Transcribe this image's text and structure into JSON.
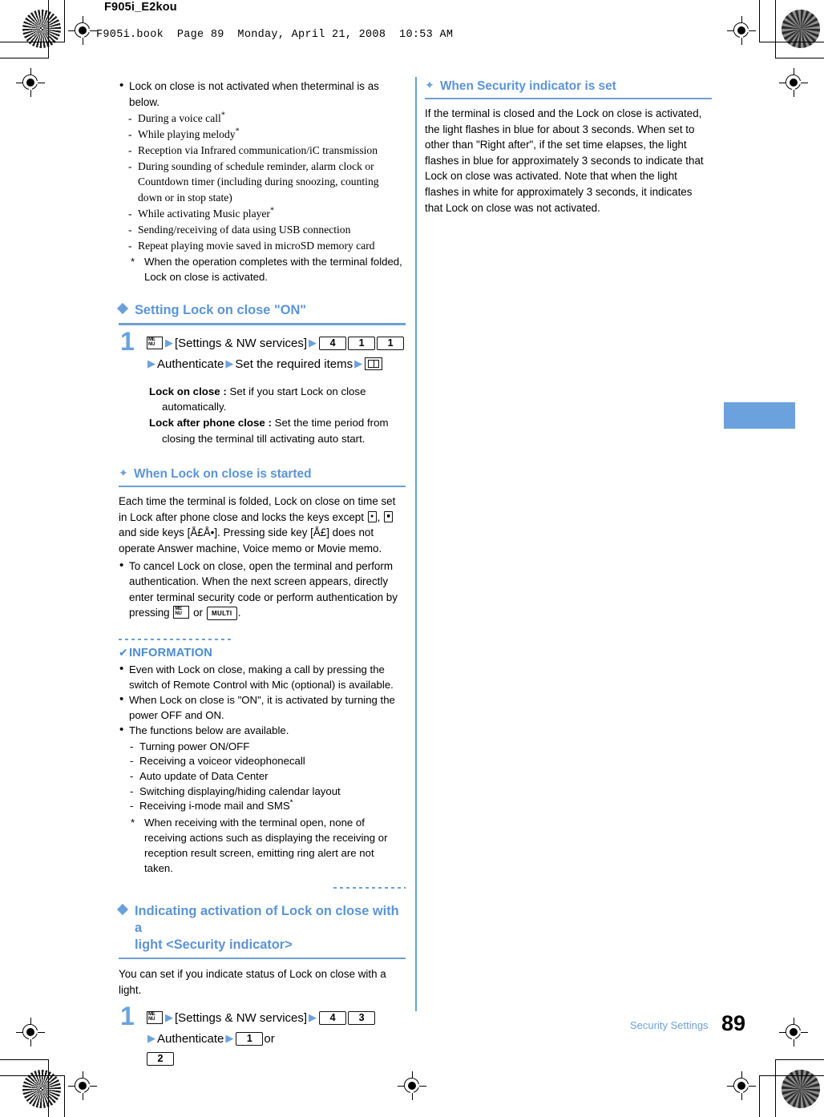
{
  "header": {
    "doc_id": "F905i_E2kou",
    "book_line": "F905i.book  Page 89  Monday, April 21, 2008  10:53 AM"
  },
  "colors": {
    "accent_blue": "#6ba2dd",
    "heading_blue": "#5b94d6",
    "rule_blue": "#6b9fd4"
  },
  "left_column": {
    "intro_bullet": "Lock on close is not activated when theterminal is as below.",
    "intro_dashes": [
      "During a voice call",
      "While playing melody",
      "Reception via Infrared communication/iC transmission",
      "During sounding of schedule reminder, alarm clock or Countdown timer (including during snoozing, counting down or in stop state)",
      "While activating Music player",
      "Sending/receiving of data using USB connection",
      "Repeat playing movie saved in microSD memory card"
    ],
    "intro_dash_asterisk": [
      true,
      true,
      false,
      false,
      true,
      false,
      false
    ],
    "intro_footnote": "When the operation completes with the terminal folded, Lock on close is activated.",
    "section1": {
      "heading": "Setting Lock on close \"ON\"",
      "step_number": "1",
      "step_parts": [
        {
          "type": "icon",
          "icon": "menu-key-icon"
        },
        {
          "type": "arrow"
        },
        {
          "type": "text",
          "text": "[Settings & NW services]"
        },
        {
          "type": "arrow"
        },
        {
          "type": "key",
          "label": "4"
        },
        {
          "type": "key",
          "label": "1"
        },
        {
          "type": "key",
          "label": "1"
        },
        {
          "type": "arrow"
        },
        {
          "type": "text",
          "text": "Authenticate"
        },
        {
          "type": "arrow"
        },
        {
          "type": "text",
          "text": "Set the required items"
        },
        {
          "type": "arrow"
        },
        {
          "type": "icon",
          "icon": "book-key-icon"
        }
      ],
      "desc": [
        {
          "term": "Lock on close :",
          "text": " Set if you start Lock on close automatically."
        },
        {
          "term": "Lock after phone close :",
          "text": " Set the time period from closing the terminal till activating auto start."
        }
      ]
    },
    "section2": {
      "heading": "When Lock on close is started",
      "para_a": "Each time the terminal is folded, Lock on close on time set in Lock after phone close and locks the keys except ",
      "para_b": ", ",
      "para_c": " and side keys [Å£Å•]. Pressing side key [Å£] does not operate Answer machine, Voice memo or Movie memo.",
      "bullet_a": "To cancel Lock on close, open the terminal and perform authentication. When the next screen appears, directly enter terminal security code or perform authentication by pressing ",
      "bullet_or": " or ",
      "bullet_end": "."
    },
    "information": {
      "title": "INFORMATION",
      "check_glyph": "✔",
      "bullets": [
        "Even with Lock on close, making a call by pressing the switch of Remote Control with Mic (optional) is available.",
        "When Lock on close is \"ON\", it is activated by turning the power OFF and ON.",
        "The functions below are available."
      ],
      "dashes": [
        "Turning power ON/OFF",
        "Receiving a voiceor videophonecall",
        "Auto update of Data Center",
        "Switching displaying/hiding calendar layout",
        "Receiving i-mode mail and SMS"
      ],
      "dash_asterisk": [
        false,
        false,
        false,
        false,
        true
      ],
      "footnote": "When receiving with the terminal open, none of receiving actions such as displaying the receiving or reception result screen, emitting ring alert are not taken."
    },
    "section3": {
      "heading_line1": "Indicating activation of Lock on close with a",
      "heading_line2": "light <Security indicator>",
      "para": "You can set if you indicate status of Lock on close with a light.",
      "step_number": "1",
      "step_parts": [
        {
          "type": "icon",
          "icon": "menu-key-icon"
        },
        {
          "type": "arrow"
        },
        {
          "type": "text",
          "text": "[Settings & NW services]"
        },
        {
          "type": "arrow"
        },
        {
          "type": "key",
          "label": "4"
        },
        {
          "type": "key",
          "label": "3"
        },
        {
          "type": "arrow"
        },
        {
          "type": "text",
          "text": "Authenticate"
        },
        {
          "type": "arrow"
        },
        {
          "type": "key",
          "label": "1"
        },
        {
          "type": "text",
          "text": "or"
        },
        {
          "type": "key",
          "label": "2"
        }
      ]
    }
  },
  "right_column": {
    "section": {
      "heading": "When Security indicator is set",
      "para": "If the terminal is closed and the Lock on close is activated, the light flashes in blue for about 3 seconds. When set to other than \"Right after\", if the set time elapses, the light flashes in blue for approximately 3 seconds to indicate that Lock on close was activated. Note that when the light flashes in white for approximately 3 seconds, it indicates that Lock on close was not activated."
    }
  },
  "footer": {
    "running_head": "Security Settings",
    "page_number": "89"
  }
}
